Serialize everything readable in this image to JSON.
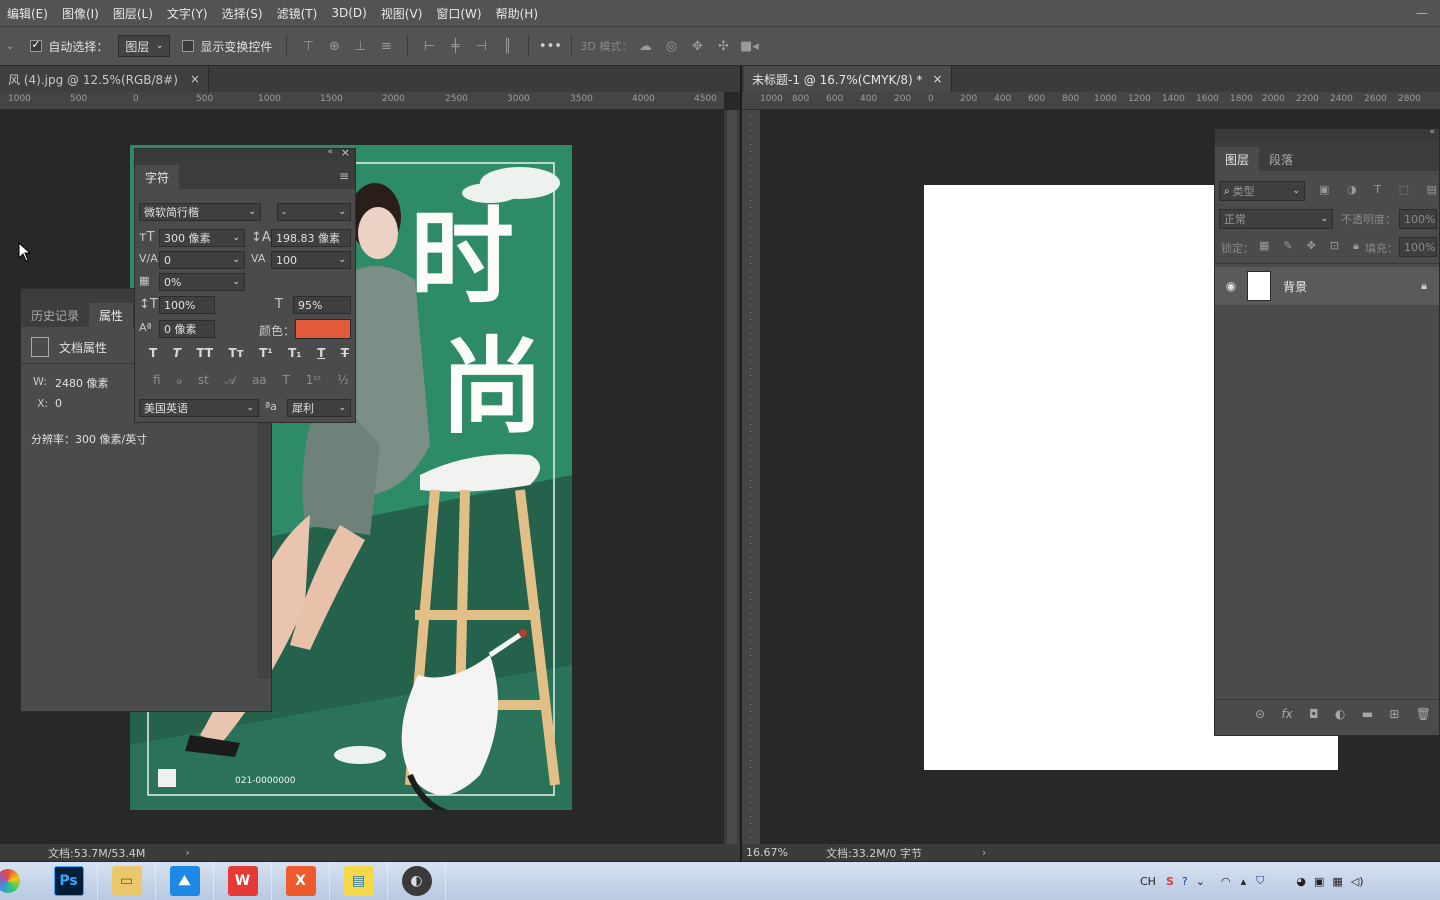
{
  "menu": [
    "编辑(E)",
    "图像(I)",
    "图层(L)",
    "文字(Y)",
    "选择(S)",
    "滤镜(T)",
    "3D(D)",
    "视图(V)",
    "窗口(W)",
    "帮助(H)"
  ],
  "options": {
    "auto_select_label": "自动选择：",
    "auto_select_value": "图层",
    "show_transform_label": "显示变换控件",
    "mode_3d_label": "3D 模式："
  },
  "doc1": {
    "tab_title": "风 (4).jpg @ 12.5%(RGB/8#)",
    "ruler_ticks": [
      "1000",
      "500",
      "0",
      "500",
      "1000",
      "1500",
      "2000",
      "2500",
      "3000",
      "3500",
      "4000",
      "4500"
    ],
    "status_text": "文档:53.7M/53.4M"
  },
  "doc2": {
    "tab_title": "未标题-1 @ 16.7%(CMYK/8) *",
    "ruler_ticks": [
      "1000",
      "800",
      "600",
      "400",
      "200",
      "0",
      "200",
      "400",
      "600",
      "800",
      "1000",
      "1200",
      "1400",
      "1600",
      "1800",
      "2000",
      "2200",
      "2400",
      "2600",
      "2800"
    ],
    "zoom": "16.67%",
    "status_text": "文档:33.2M/0 字节"
  },
  "poster": {
    "headline_1": "时",
    "headline_2": "尚",
    "phone": "021-0000000"
  },
  "character_panel": {
    "tab": "字符",
    "font_family": "微软简行楷",
    "font_style": "-",
    "font_size": "300 像素",
    "leading": "198.83 像素",
    "kerning": "0",
    "tracking": "100",
    "tsume": "0%",
    "vertical_scale": "100%",
    "horizontal_scale": "95%",
    "baseline_shift": "0 像素",
    "color_label": "颜色：",
    "color": "#e35a3d",
    "language": "美国英语",
    "antialias": "犀利"
  },
  "properties_panel": {
    "tabs": [
      "历史记录",
      "属性"
    ],
    "section_title": "文档属性",
    "width_label": "W:",
    "width_value": "2480 像素",
    "x_label": "X:",
    "x_value": "0",
    "resolution": "分辨率：300 像素/英寸"
  },
  "layers_panel": {
    "tabs": [
      "图层",
      "段落"
    ],
    "filter_placeholder": "类型",
    "blend_mode": "正常",
    "opacity_label": "不透明度：",
    "opacity_value": "100%",
    "lock_label": "锁定：",
    "fill_label": "填充：",
    "fill_value": "100%",
    "layer_name": "背景"
  },
  "taskbar": {
    "apps": [
      "Ps",
      "Explorer",
      "Maps",
      "W",
      "X",
      "Notepad",
      "Photo"
    ],
    "tray_lang": "CH"
  }
}
